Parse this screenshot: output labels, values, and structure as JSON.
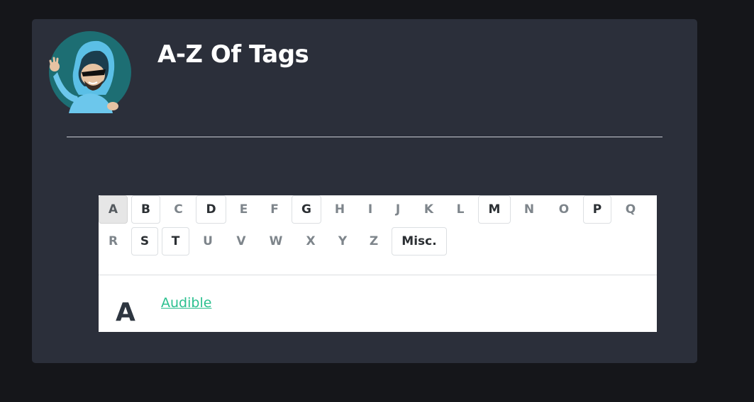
{
  "header": {
    "title": "A-Z Of Tags",
    "avatar_icon": "hooded-hacker-avatar-icon"
  },
  "colors": {
    "page_background": "#15161a",
    "card_background": "#2b2f3a",
    "link": "#2bc08f",
    "active_letter_background": "#e6e6e6"
  },
  "letter_nav": {
    "row1": [
      {
        "label": "A",
        "state": "active"
      },
      {
        "label": "B",
        "state": "has-tags"
      },
      {
        "label": "C",
        "state": "empty"
      },
      {
        "label": "D",
        "state": "has-tags"
      },
      {
        "label": "E",
        "state": "empty"
      },
      {
        "label": "F",
        "state": "empty"
      },
      {
        "label": "G",
        "state": "has-tags"
      },
      {
        "label": "H",
        "state": "empty"
      },
      {
        "label": "I",
        "state": "empty"
      },
      {
        "label": "J",
        "state": "empty"
      },
      {
        "label": "K",
        "state": "empty"
      },
      {
        "label": "L",
        "state": "empty"
      },
      {
        "label": "M",
        "state": "has-tags"
      },
      {
        "label": "N",
        "state": "empty"
      },
      {
        "label": "O",
        "state": "empty"
      },
      {
        "label": "P",
        "state": "has-tags"
      },
      {
        "label": "Q",
        "state": "empty"
      }
    ],
    "row2": [
      {
        "label": "R",
        "state": "empty"
      },
      {
        "label": "S",
        "state": "has-tags"
      },
      {
        "label": "T",
        "state": "has-tags"
      },
      {
        "label": "U",
        "state": "empty"
      },
      {
        "label": "V",
        "state": "empty"
      },
      {
        "label": "W",
        "state": "empty"
      },
      {
        "label": "X",
        "state": "empty"
      },
      {
        "label": "Y",
        "state": "empty"
      },
      {
        "label": "Z",
        "state": "empty"
      },
      {
        "label": "Misc.",
        "state": "has-tags"
      }
    ]
  },
  "sections": [
    {
      "letter": "A",
      "tags": [
        "Audible"
      ]
    }
  ]
}
